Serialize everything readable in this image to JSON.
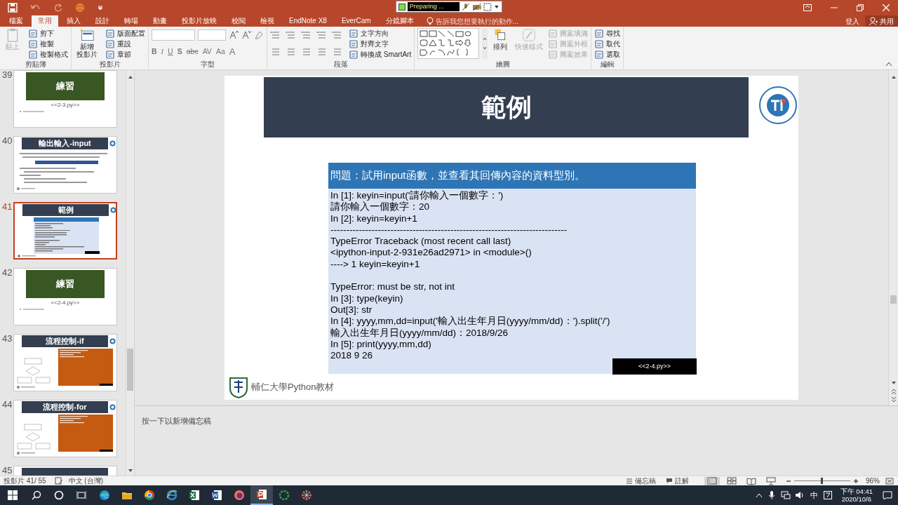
{
  "title_bar": {
    "recorder_status": "Preparing ..."
  },
  "ribbon_tabs": [
    {
      "label": "檔案",
      "selected": false
    },
    {
      "label": "常用",
      "selected": true
    },
    {
      "label": "插入",
      "selected": false
    },
    {
      "label": "設計",
      "selected": false
    },
    {
      "label": "轉場",
      "selected": false
    },
    {
      "label": "動畫",
      "selected": false
    },
    {
      "label": "投影片放映",
      "selected": false
    },
    {
      "label": "校閱",
      "selected": false
    },
    {
      "label": "檢視",
      "selected": false
    },
    {
      "label": "EndNote X8",
      "selected": false
    },
    {
      "label": "EverCam",
      "selected": false
    },
    {
      "label": "分鏡腳本",
      "selected": false
    }
  ],
  "tell_me": "告訴我您想要執行的動作...",
  "account": {
    "sign_in": "登入",
    "share": "共用"
  },
  "ribbon_groups": [
    {
      "kind": "clipboard",
      "name": "剪貼簿",
      "big_button": {
        "lines": [
          "貼上"
        ],
        "disabled": true
      },
      "buttons": [
        {
          "label": "剪下",
          "disabled": false
        },
        {
          "label": "複製",
          "disabled": false
        },
        {
          "label": "複製格式",
          "disabled": false
        }
      ]
    },
    {
      "kind": "slides",
      "name": "投影片",
      "big_button": {
        "lines": [
          "新增",
          "投影片"
        ],
        "disabled": false
      },
      "buttons": [
        {
          "label": "版面配置",
          "disabled": false
        },
        {
          "label": "重設",
          "disabled": false
        },
        {
          "label": "章節",
          "disabled": false
        }
      ]
    },
    {
      "kind": "font",
      "name": "字型",
      "format_buttons": [
        "B",
        "I",
        "U",
        "S",
        "abc",
        "AV",
        "Aa",
        "A"
      ]
    },
    {
      "kind": "paragraph",
      "name": "段落",
      "buttons": [
        {
          "label": "文字方向",
          "disabled": false
        },
        {
          "label": "對齊文字",
          "disabled": false
        },
        {
          "label": "轉換成 SmartArt",
          "disabled": false
        }
      ]
    },
    {
      "kind": "drawing",
      "name": "繪圖",
      "big_buttons": [
        {
          "lines": [
            "排列"
          ],
          "disabled": false
        },
        {
          "lines": [
            "快速樣式"
          ],
          "disabled": true
        }
      ],
      "buttons": [
        {
          "label": "圖案填滿",
          "disabled": true
        },
        {
          "label": "圖案外框",
          "disabled": true
        },
        {
          "label": "圖案效果",
          "disabled": true
        }
      ]
    },
    {
      "kind": "editing",
      "name": "編輯",
      "buttons": [
        {
          "label": "尋找",
          "disabled": false
        },
        {
          "label": "取代",
          "disabled": false
        },
        {
          "label": "選取",
          "disabled": false
        }
      ]
    }
  ],
  "thumbnails": [
    {
      "number": "39",
      "selected": false,
      "kind": "practice",
      "title": "練習",
      "caption": "<<2-3.py>>"
    },
    {
      "number": "40",
      "selected": false,
      "kind": "bullets",
      "title": "輸出輸入-input"
    },
    {
      "number": "41",
      "selected": true,
      "kind": "code",
      "title": "範例"
    },
    {
      "number": "42",
      "selected": false,
      "kind": "practice",
      "title": "練習",
      "caption": "<<2-4.py>>"
    },
    {
      "number": "43",
      "selected": false,
      "kind": "flow",
      "title": "流程控制-if"
    },
    {
      "number": "44",
      "selected": false,
      "kind": "flow",
      "title": "流程控制-for"
    },
    {
      "number": "45",
      "selected": false,
      "kind": "cut"
    }
  ],
  "slide": {
    "title": "範例",
    "question": "問題：試用input函數，並查看其回傳內容的資料型別。",
    "code_blocks": [
      {
        "lines": [
          "In [1]: keyin=input('請你輸入一個數字：')",
          "請你輸入一個數字：20",
          "In [2]: keyin=keyin+1",
          "---------------------------------------------------------------------------",
          "TypeError Traceback (most recent call last)",
          "<ipython-input-2-931e26ad2971> in <module>()",
          "----> 1 keyin=keyin+1"
        ]
      },
      {
        "lines": [
          "TypeError: must be str, not int",
          "In [3]: type(keyin)",
          "Out[3]: str",
          "In [4]: yyyy,mm,dd=input('輸入出生年月日(yyyy/mm/dd)：').split('/')",
          "輸入出生年月日(yyyy/mm/dd)：2018/9/26",
          "In [5]: print(yyyy,mm,dd)",
          "2018 9 26"
        ]
      }
    ],
    "file_tag": "<<2-4.py>>",
    "footer": "輔仁大學Python教材"
  },
  "notes_placeholder": "按一下以新增備忘稿",
  "status_bar": {
    "slide_counter": "投影片 41/ 55",
    "language": "中文 (台灣)",
    "notes": "備忘稿",
    "comments": "註解",
    "views": [
      {
        "kind": "normal",
        "selected": true
      },
      {
        "kind": "sorter",
        "selected": false
      },
      {
        "kind": "reading",
        "selected": false
      },
      {
        "kind": "slideshow",
        "selected": false
      }
    ],
    "zoom_slider": {
      "level": 0.5
    },
    "zoom": "96%"
  },
  "taskbar": {
    "apps": [
      {
        "kind": "edge",
        "active": false
      },
      {
        "kind": "explorer",
        "active": false
      },
      {
        "kind": "chrome",
        "active": false
      },
      {
        "kind": "ie",
        "active": false
      },
      {
        "kind": "excel",
        "active": false
      },
      {
        "kind": "word",
        "active": false
      },
      {
        "kind": "firefox",
        "active": false
      },
      {
        "kind": "powerpoint",
        "active": true
      },
      {
        "kind": "ring",
        "active": false
      },
      {
        "kind": "spider",
        "active": false
      }
    ],
    "ime": "中",
    "time": "下午 04:41",
    "date": "2020/10/6"
  }
}
